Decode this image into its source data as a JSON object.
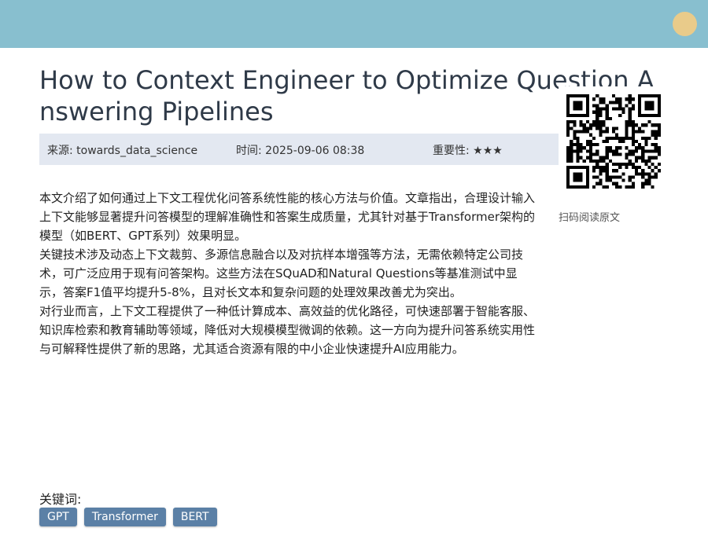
{
  "header": {
    "accent_color": "#88bfcf",
    "avatar_color": "#e9cb8a"
  },
  "article": {
    "title": "How to Context Engineer to Optimize Question Answering Pipelines",
    "meta": {
      "source": "来源: towards_data_science",
      "time": "时间: 2025-09-06 08:38",
      "importance": "重要性: ★★★"
    },
    "paragraphs": [
      "本文介绍了如何通过上下文工程优化问答系统性能的核心方法与价值。文章指出，合理设计输入上下文能够显著提升问答模型的理解准确性和答案生成质量，尤其针对基于Transformer架构的模型（如BERT、GPT系列）效果明显。",
      "关键技术涉及动态上下文裁剪、多源信息融合以及对抗样本增强等方法，无需依赖特定公司技术，可广泛应用于现有问答架构。这些方法在SQuAD和Natural Questions等基准测试中显示，答案F1值平均提升5-8%，且对长文本和复杂问题的处理效果改善尤为突出。",
      "对行业而言，上下文工程提供了一种低计算成本、高效益的优化路径，可快速部署于智能客服、知识库检索和教育辅助等领域，降低对大规模模型微调的依赖。这一方向为提升问答系统实用性与可解释性提供了新的思路，尤其适合资源有限的中小企业快速提升AI应用能力。"
    ],
    "qr_caption": "扫码阅读原文",
    "keywords_label": "关键词:",
    "keywords": [
      "GPT",
      "Transformer",
      "BERT"
    ]
  }
}
